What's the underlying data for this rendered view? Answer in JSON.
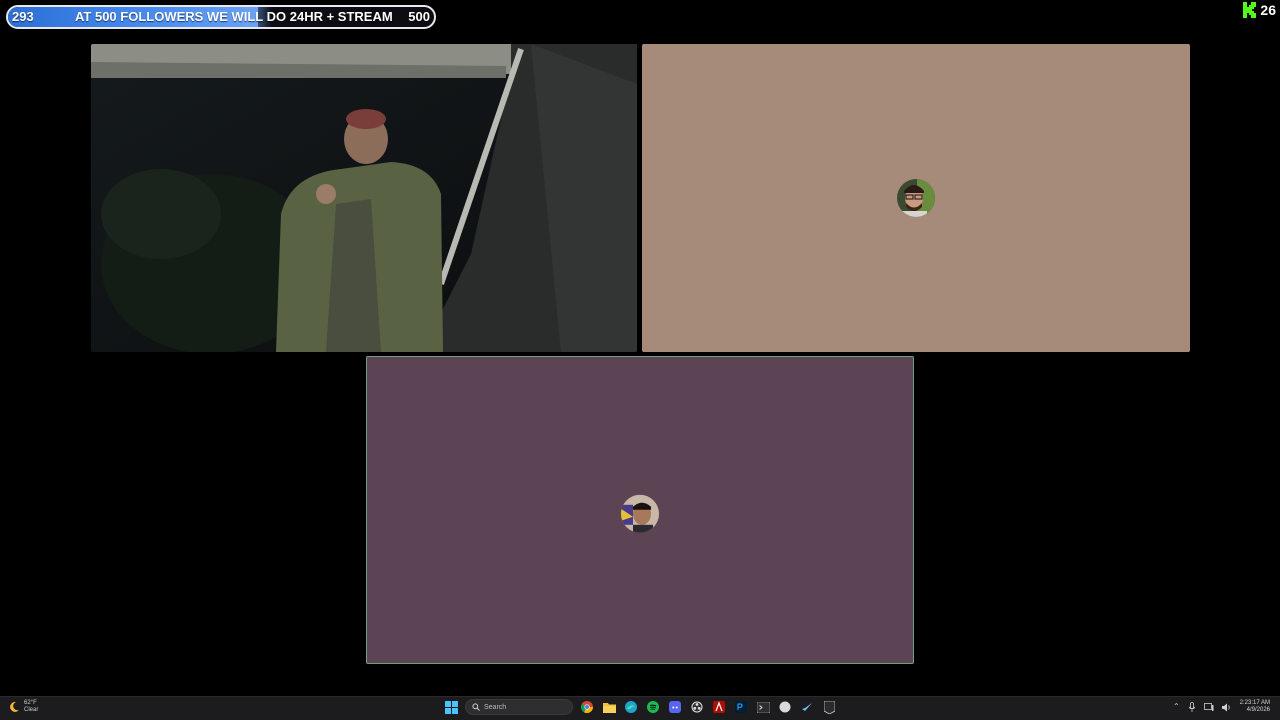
{
  "goal": {
    "current": "293",
    "text": "AT 500 FOLLOWERS WE WILL DO 24HR + STREAM",
    "target": "500",
    "progress_percent": 58.6,
    "fill_color": "#3d82e8"
  },
  "kick": {
    "viewers": "26",
    "brand_color": "#53fc18",
    "icon": "kick-logo-icon"
  },
  "tiles": {
    "participant_2": {
      "bg_color": "#a68a7a"
    },
    "participant_3": {
      "bg_color": "#5c4455",
      "active_speaker_border": "#6fa07a"
    }
  },
  "taskbar": {
    "weather": {
      "temp": "62°F",
      "condition": "Clear"
    },
    "search_placeholder": "Search",
    "apps": [
      "chrome-icon",
      "file-explorer-icon",
      "edge-icon",
      "spotify-icon",
      "discord-icon",
      "obs-icon",
      "acrobat-icon",
      "photoshop-icon",
      "terminal-icon",
      "app-circle-icon",
      "steam-icon",
      "epic-games-icon"
    ],
    "clock": {
      "time": "2:23:17 AM",
      "date": "4/9/2026"
    }
  }
}
